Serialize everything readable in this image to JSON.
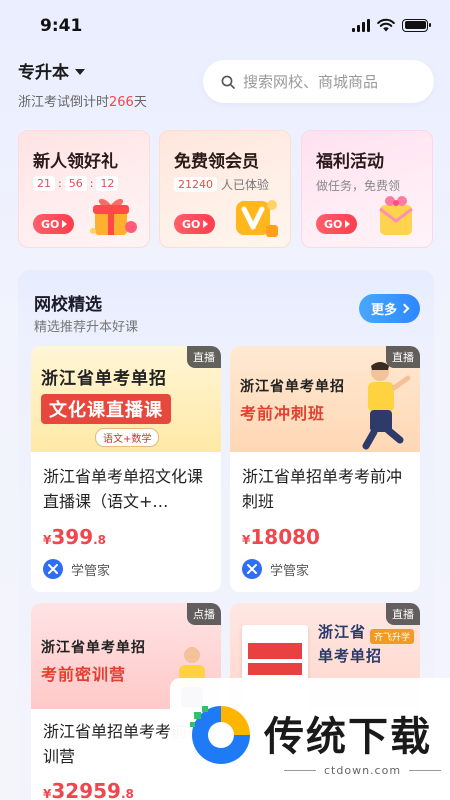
{
  "status_bar": {
    "time": "9:41"
  },
  "header": {
    "level": "专升本",
    "countdown_prefix": "浙江考试倒计时",
    "countdown_days": "266",
    "countdown_suffix": "天"
  },
  "search": {
    "placeholder": "搜索网校、商城商品"
  },
  "promos": [
    {
      "title": "新人领好礼",
      "timer": [
        "21",
        "56",
        "12"
      ],
      "go": "GO"
    },
    {
      "title": "免费领会员",
      "count": "21240",
      "count_suffix": "人已体验",
      "go": "GO"
    },
    {
      "title": "福利活动",
      "subtitle": "做任务，免费领",
      "go": "GO"
    }
  ],
  "section": {
    "title": "网校精选",
    "subtitle": "精选推荐升本好课",
    "more": "更多"
  },
  "courses": [
    {
      "tag": "直播",
      "cover_line1": "浙江省单考单招",
      "cover_line2": "文化课直播课",
      "cover_pill": "语文+数学",
      "title": "浙江省单考单招文化课直播课（语文+…",
      "currency": "¥",
      "price_int": "399",
      "price_dec": ".8",
      "teacher": "学管家"
    },
    {
      "tag": "直播",
      "cover_line1": "浙江省单考单招",
      "cover_line2": "考前冲刺班",
      "title": "浙江省单招单考考前冲刺班",
      "currency": "¥",
      "price_int": "18080",
      "price_dec": "",
      "teacher": "学管家"
    },
    {
      "tag": "点播",
      "cover_line1": "浙江省单考单招",
      "cover_line2": "考前密训营",
      "title": "浙江省单招单考考前密训营",
      "currency": "¥",
      "price_int": "32959",
      "price_dec": ".8"
    },
    {
      "tag": "直播",
      "cover_line1": "浙江省",
      "cover_line2": "单考单招",
      "brand_pill": "齐飞升学"
    }
  ],
  "watermark": {
    "text": "传统下载",
    "url": "ctdown.com"
  },
  "colors": {
    "accent_red": "#f0474e",
    "accent_blue": "#2d87ff"
  }
}
